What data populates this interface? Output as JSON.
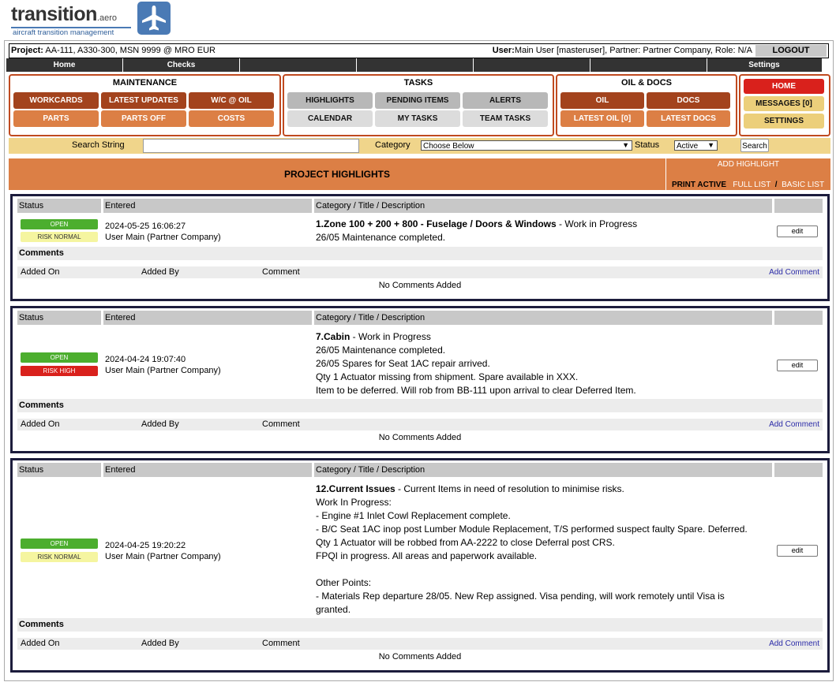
{
  "logo": {
    "word": "transition",
    "suffix": ".aero",
    "tagline": "aircraft transition management",
    "icon": "airplane-icon"
  },
  "project": {
    "label": "Project:",
    "value": "AA-111, A330-300, MSN 9999 @ MRO EUR"
  },
  "user": {
    "label": "User:",
    "value": "Main User [masteruser], Partner: Partner Company, Role: N/A"
  },
  "logout": "LOGOUT",
  "nav": [
    "Home",
    "Checks",
    "",
    "",
    "",
    "",
    "Settings"
  ],
  "maintenance": {
    "title": "MAINTENANCE",
    "buttons": [
      "WORKCARDS",
      "LATEST UPDATES",
      "W/C @ OIL",
      "PARTS",
      "PARTS OFF",
      "COSTS"
    ]
  },
  "tasks": {
    "title": "TASKS",
    "buttons": [
      "HIGHLIGHTS",
      "PENDING ITEMS",
      "ALERTS",
      "CALENDAR",
      "MY TASKS",
      "TEAM TASKS"
    ]
  },
  "oil_docs": {
    "title": "OIL & DOCS",
    "buttons": [
      "OIL",
      "DOCS",
      "LATEST OIL [0]",
      "LATEST DOCS"
    ]
  },
  "side": {
    "home": "HOME",
    "messages": "MESSAGES [0]",
    "settings": "SETTINGS"
  },
  "search": {
    "label": "Search String",
    "value": "",
    "category_label": "Category",
    "category_value": "Choose Below",
    "status_label": "Status",
    "status_value": "Active",
    "button": "Search"
  },
  "highlights": {
    "title": "PROJECT HIGHLIGHTS",
    "add": "ADD HIGHLIGHT",
    "print_active": "PRINT ACTIVE",
    "full_list": "FULL LIST",
    "sep": "/",
    "basic_list": "BASIC LIST"
  },
  "columns": {
    "status": "Status",
    "entered": "Entered",
    "cat": "Category / Title / Description"
  },
  "comments": {
    "title": "Comments",
    "added_on": "Added On",
    "added_by": "Added By",
    "comment": "Comment",
    "add": "Add Comment",
    "none": "No Comments Added"
  },
  "items": [
    {
      "status": "OPEN",
      "risk": "RISK NORMAL",
      "date": "2024-05-25 16:06:27",
      "by": "User Main (Partner Company)",
      "title": "1.Zone 100 + 200 + 800 - Fuselage / Doors & Windows",
      "state": " - Work in Progress",
      "lines": [
        "26/05 Maintenance completed."
      ],
      "edit": "edit"
    },
    {
      "status": "OPEN",
      "risk": "RISK HIGH",
      "date": "2024-04-24 19:07:40",
      "by": "User Main (Partner Company)",
      "title": "7.Cabin",
      "state": " - Work in Progress",
      "lines": [
        "26/05 Maintenance completed.",
        "26/05 Spares for Seat 1AC repair arrived.",
        "Qty 1 Actuator missing from shipment. Spare available in XXX.",
        "Item to be deferred. Will rob from BB-111 upon arrival to clear Deferred Item."
      ],
      "edit": "edit"
    },
    {
      "status": "OPEN",
      "risk": "RISK NORMAL",
      "date": "2024-04-25 19:20:22",
      "by": "User Main (Partner Company)",
      "title": "12.Current Issues",
      "state": " - Current Items in need of resolution to minimise risks.",
      "lines": [
        "Work In Progress:",
        "- Engine #1 Inlet Cowl Replacement complete.",
        "- B/C Seat 1AC inop post Lumber Module Replacement, T/S performed suspect faulty Spare. Deferred.",
        "Qty 1 Actuator will be robbed from AA-2222 to close Deferral post CRS.",
        "FPQI in progress. All areas and paperwork available.",
        "",
        "Other Points:",
        "- Materials Rep departure 28/05. New Rep assigned. Visa pending, will work remotely until Visa is",
        "granted."
      ],
      "edit": "edit"
    }
  ]
}
